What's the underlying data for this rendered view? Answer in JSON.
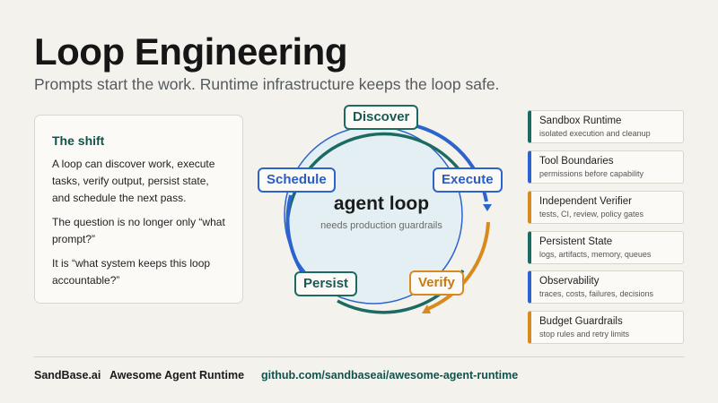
{
  "header": {
    "title": "Loop Engineering",
    "subtitle": "Prompts start the work. Runtime infrastructure keeps the loop safe."
  },
  "shift": {
    "title": "The shift",
    "p1": "A loop can discover work, execute tasks, verify output, persist state, and schedule the next pass.",
    "p2": "The question is no longer only “what prompt?”",
    "p3": "It is “what system keeps this loop accountable?”"
  },
  "loop": {
    "center_title": "agent loop",
    "center_subtitle": "needs production guardrails",
    "nodes": {
      "discover": "Discover",
      "execute": "Execute",
      "verify": "Verify",
      "persist": "Persist",
      "schedule": "Schedule"
    }
  },
  "capabilities": [
    {
      "title": "Sandbox Runtime",
      "desc": "isolated execution and cleanup"
    },
    {
      "title": "Tool Boundaries",
      "desc": "permissions before capability"
    },
    {
      "title": "Independent Verifier",
      "desc": "tests, CI, review, policy gates"
    },
    {
      "title": "Persistent State",
      "desc": "logs, artifacts, memory, queues"
    },
    {
      "title": "Observability",
      "desc": "traces, costs, failures, decisions"
    },
    {
      "title": "Budget Guardrails",
      "desc": "stop rules and retry limits"
    }
  ],
  "footer": {
    "brand": "SandBase.ai",
    "product": "Awesome Agent Runtime",
    "link": "github.com/sandbaseai/awesome-agent-runtime"
  },
  "colors": {
    "teal": "#1b6b62",
    "blue": "#2c63cf",
    "orange": "#d88a1f",
    "background": "#f4f2ec"
  }
}
